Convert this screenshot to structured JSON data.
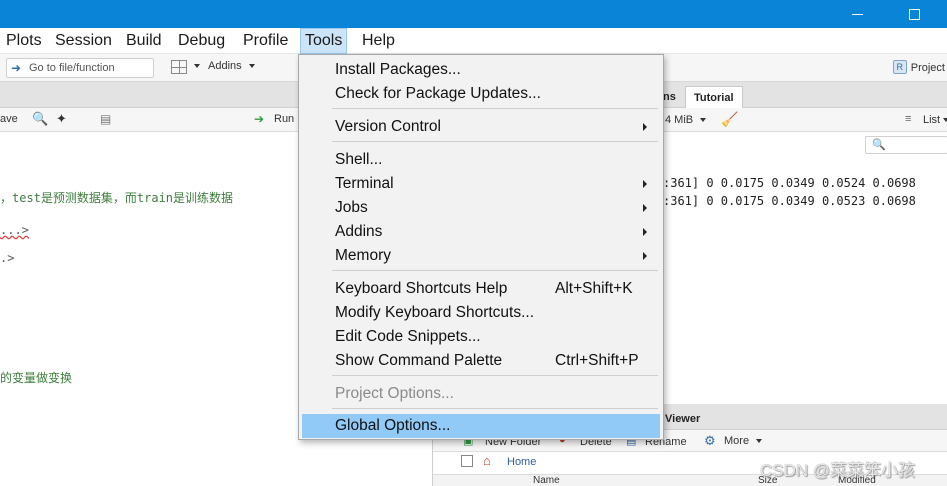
{
  "window": {
    "minimize_icon": "minimize-icon",
    "maximize_icon": "maximize-icon"
  },
  "menubar": {
    "items": [
      {
        "label": "Plots"
      },
      {
        "label": "Session"
      },
      {
        "label": "Build"
      },
      {
        "label": "Debug"
      },
      {
        "label": "Profile"
      },
      {
        "label": "Tools",
        "active": true
      },
      {
        "label": "Help"
      }
    ]
  },
  "toolbar": {
    "goto_placeholder": "Go to file/function",
    "addins_label": "Addins",
    "project_label": "Project"
  },
  "editor": {
    "save_label": "ave",
    "run_label": "Run",
    "lines": [
      {
        "text": "，test是预测数据集，而train是训练数据"
      },
      {
        "text": "...>"
      },
      {
        "text": ".>"
      },
      {
        "text": "的变量做变换"
      }
    ]
  },
  "environment": {
    "tabs": [
      {
        "label": "ns"
      },
      {
        "label": "Tutorial"
      }
    ],
    "memory_label": "4 MiB",
    "list_label": "List",
    "rows": [
      {
        "text": ":361] 0 0.0175 0.0349 0.0524 0.0698"
      },
      {
        "text": ":361] 0 0.0175 0.0349 0.0523 0.0698"
      }
    ]
  },
  "files": {
    "tab_label": "Viewer",
    "new_folder_label": "New Folder",
    "delete_label": "Delete",
    "rename_label": "Rename",
    "more_label": "More",
    "home_label": "Home",
    "col_name": "Name",
    "col_size": "Size",
    "col_modified": "Modified"
  },
  "tools_menu": {
    "items": [
      {
        "label": "Install Packages...",
        "shortcut": "",
        "submenu": false,
        "disabled": false,
        "highlight": false
      },
      {
        "label": "Check for Package Updates...",
        "shortcut": "",
        "submenu": false,
        "disabled": false,
        "highlight": false
      },
      {
        "label": "Version Control",
        "shortcut": "",
        "submenu": true,
        "disabled": false,
        "highlight": false
      },
      {
        "label": "Shell...",
        "shortcut": "",
        "submenu": false,
        "disabled": false,
        "highlight": false
      },
      {
        "label": "Terminal",
        "shortcut": "",
        "submenu": true,
        "disabled": false,
        "highlight": false
      },
      {
        "label": "Jobs",
        "shortcut": "",
        "submenu": true,
        "disabled": false,
        "highlight": false
      },
      {
        "label": "Addins",
        "shortcut": "",
        "submenu": true,
        "disabled": false,
        "highlight": false
      },
      {
        "label": "Memory",
        "shortcut": "",
        "submenu": true,
        "disabled": false,
        "highlight": false
      },
      {
        "label": "Keyboard Shortcuts Help",
        "shortcut": "Alt+Shift+K",
        "submenu": false,
        "disabled": false,
        "highlight": false
      },
      {
        "label": "Modify Keyboard Shortcuts...",
        "shortcut": "",
        "submenu": false,
        "disabled": false,
        "highlight": false
      },
      {
        "label": "Edit Code Snippets...",
        "shortcut": "",
        "submenu": false,
        "disabled": false,
        "highlight": false
      },
      {
        "label": "Show Command Palette",
        "shortcut": "Ctrl+Shift+P",
        "submenu": false,
        "disabled": false,
        "highlight": false
      },
      {
        "label": "Project Options...",
        "shortcut": "",
        "submenu": false,
        "disabled": true,
        "highlight": false
      },
      {
        "label": "Global Options...",
        "shortcut": "",
        "submenu": false,
        "disabled": false,
        "highlight": true
      }
    ]
  },
  "watermark": "CSDN @菜菜笨小孩",
  "colors": {
    "titlebar": "#0a84d6",
    "menu_highlight": "#91c9f7",
    "menubar_active": "#cce4f7"
  }
}
